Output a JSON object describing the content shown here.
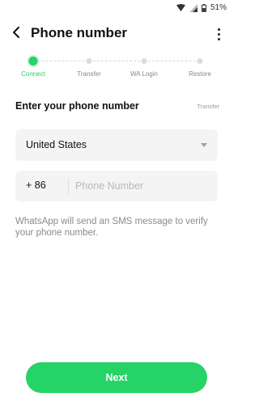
{
  "status_bar": {
    "battery_text": "51%"
  },
  "header": {
    "title": "Phone number"
  },
  "stepper": {
    "steps": [
      {
        "label": "Connect",
        "active": true
      },
      {
        "label": "Transfer",
        "active": false
      },
      {
        "label": "WA Login",
        "active": false
      },
      {
        "label": "Restore",
        "active": false
      }
    ]
  },
  "form": {
    "heading": "Enter your phone number",
    "transfer_link": "Transfer",
    "country_value": "United States",
    "country_code": "+ 86",
    "phone_value": "",
    "phone_placeholder": "Phone Number",
    "info_text": "WhatsApp will send an SMS message to verify your phone number."
  },
  "actions": {
    "next_label": "Next"
  },
  "colors": {
    "accent": "#25D366",
    "inactive": "#dcdcdc",
    "muted_text": "#8a8a8a"
  },
  "icons": [
    "wifi-icon",
    "signal-icon",
    "battery-icon",
    "back-arrow-icon",
    "more-vert-icon",
    "dropdown-triangle-icon"
  ]
}
